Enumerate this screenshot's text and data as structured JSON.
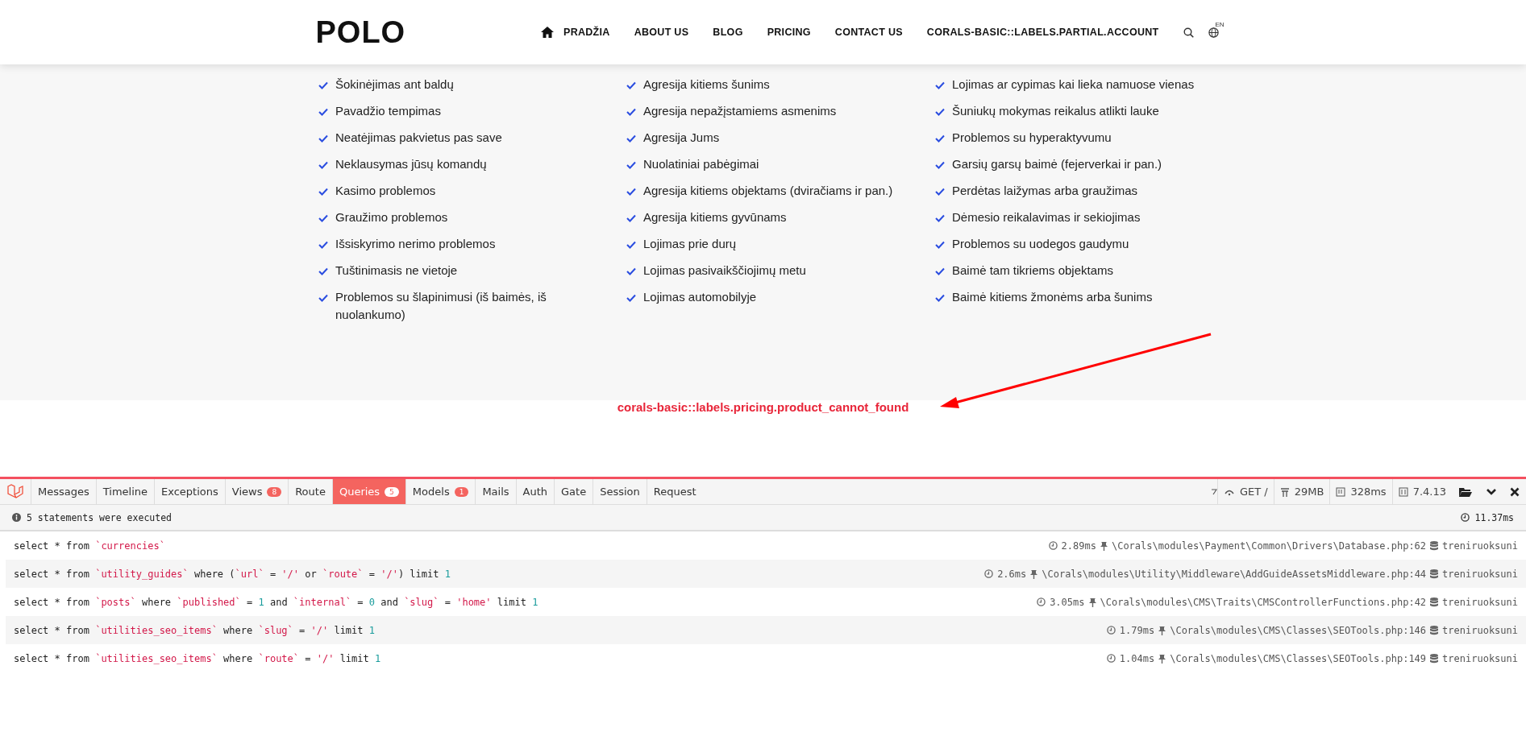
{
  "header": {
    "logo": "POLO",
    "nav": [
      {
        "label": "PRADŽIA",
        "home": true
      },
      {
        "label": "ABOUT US",
        "home": false
      },
      {
        "label": "BLOG",
        "home": false
      },
      {
        "label": "PRICING",
        "home": false
      },
      {
        "label": "CONTACT US",
        "home": false
      },
      {
        "label": "CORALS-BASIC::LABELS.PARTIAL.ACCOUNT",
        "home": false
      }
    ],
    "language": "EN"
  },
  "problem_columns": [
    [
      "Šokinėjimas ant baldų",
      "Pavadžio tempimas",
      "Neatėjimas pakvietus pas save",
      "Neklausymas jūsų komandų",
      "Kasimo problemos",
      "Graužimo problemos",
      "Išsiskyrimo nerimo problemos",
      "Tuštinimasis ne vietoje",
      "Problemos su šlapinimusi (iš baimės, iš nuolankumo)"
    ],
    [
      "Agresija kitiems šunims",
      "Agresija nepažįstamiems asmenims",
      "Agresija Jums",
      "Nuolatiniai pabėgimai",
      "Agresija kitiems objektams (dviračiams ir pan.)",
      "Agresija kitiems gyvūnams",
      "Lojimas prie durų",
      "Lojimas pasivaikščiojimų metu",
      "Lojimas automobilyje"
    ],
    [
      "Lojimas ar cypimas kai lieka namuose vienas",
      "Šuniukų mokymas reikalus atlikti lauke",
      "Problemos su hyperaktyvumu",
      "Garsių garsų baimė (fejerverkai ir pan.)",
      "Perdėtas laižymas arba graužimas",
      "Dėmesio reikalavimas ir sekiojimas",
      "Problemos su uodegos gaudymu",
      "Baimė tam tikriems objektams",
      "Baimė kitiems žmonėms arba šunims"
    ]
  ],
  "error_message": "corals-basic::labels.pricing.product_cannot_found",
  "debugbar": {
    "tabs": [
      {
        "label": "Messages",
        "selected": false
      },
      {
        "label": "Timeline",
        "selected": false
      },
      {
        "label": "Exceptions",
        "selected": false
      },
      {
        "label": "Views",
        "badge": "8",
        "selected": false
      },
      {
        "label": "Route",
        "selected": false
      },
      {
        "label": "Queries",
        "badge": "5",
        "selected": true
      },
      {
        "label": "Models",
        "badge": "1",
        "selected": false
      },
      {
        "label": "Mails",
        "selected": false
      },
      {
        "label": "Auth",
        "selected": false
      },
      {
        "label": "Gate",
        "selected": false
      },
      {
        "label": "Session",
        "selected": false
      },
      {
        "label": "Request",
        "selected": false
      }
    ],
    "request": "GET /",
    "memory": "29MB",
    "duration": "328ms",
    "php_version": "7.4.13",
    "summary": "5 statements were executed",
    "total_time": "11.37ms",
    "queries": [
      {
        "sql": [
          {
            "kind": "text",
            "text": "select * from "
          },
          {
            "kind": "str",
            "text": "`currencies`"
          }
        ],
        "time": "2.89ms",
        "source": "\\Corals\\modules\\Payment\\Common\\Drivers\\Database.php:62",
        "connection": "treniruoksuni"
      },
      {
        "sql": [
          {
            "kind": "text",
            "text": "select * from "
          },
          {
            "kind": "str",
            "text": "`utility_guides`"
          },
          {
            "kind": "text",
            "text": " where ("
          },
          {
            "kind": "str",
            "text": "`url`"
          },
          {
            "kind": "text",
            "text": " = "
          },
          {
            "kind": "str",
            "text": "'/'"
          },
          {
            "kind": "text",
            "text": " or "
          },
          {
            "kind": "str",
            "text": "`route`"
          },
          {
            "kind": "text",
            "text": " = "
          },
          {
            "kind": "str",
            "text": "'/'"
          },
          {
            "kind": "text",
            "text": ") limit "
          },
          {
            "kind": "num",
            "text": "1"
          }
        ],
        "time": "2.6ms",
        "source": "\\Corals\\modules\\Utility\\Middleware\\AddGuideAssetsMiddleware.php:44",
        "connection": "treniruoksuni"
      },
      {
        "sql": [
          {
            "kind": "text",
            "text": "select * from "
          },
          {
            "kind": "str",
            "text": "`posts`"
          },
          {
            "kind": "text",
            "text": " where "
          },
          {
            "kind": "str",
            "text": "`published`"
          },
          {
            "kind": "text",
            "text": " = "
          },
          {
            "kind": "num",
            "text": "1"
          },
          {
            "kind": "text",
            "text": " and "
          },
          {
            "kind": "str",
            "text": "`internal`"
          },
          {
            "kind": "text",
            "text": " = "
          },
          {
            "kind": "num",
            "text": "0"
          },
          {
            "kind": "text",
            "text": " and "
          },
          {
            "kind": "str",
            "text": "`slug`"
          },
          {
            "kind": "text",
            "text": " = "
          },
          {
            "kind": "str",
            "text": "'home'"
          },
          {
            "kind": "text",
            "text": " limit "
          },
          {
            "kind": "num",
            "text": "1"
          }
        ],
        "time": "3.05ms",
        "source": "\\Corals\\modules\\CMS\\Traits\\CMSControllerFunctions.php:42",
        "connection": "treniruoksuni"
      },
      {
        "sql": [
          {
            "kind": "text",
            "text": "select * from "
          },
          {
            "kind": "str",
            "text": "`utilities_seo_items`"
          },
          {
            "kind": "text",
            "text": " where "
          },
          {
            "kind": "str",
            "text": "`slug`"
          },
          {
            "kind": "text",
            "text": " = "
          },
          {
            "kind": "str",
            "text": "'/'"
          },
          {
            "kind": "text",
            "text": " limit "
          },
          {
            "kind": "num",
            "text": "1"
          }
        ],
        "time": "1.79ms",
        "source": "\\Corals\\modules\\CMS\\Classes\\SEOTools.php:146",
        "connection": "treniruoksuni"
      },
      {
        "sql": [
          {
            "kind": "text",
            "text": "select * from "
          },
          {
            "kind": "str",
            "text": "`utilities_seo_items`"
          },
          {
            "kind": "text",
            "text": " where "
          },
          {
            "kind": "str",
            "text": "`route`"
          },
          {
            "kind": "text",
            "text": " = "
          },
          {
            "kind": "str",
            "text": "'/'"
          },
          {
            "kind": "text",
            "text": " limit "
          },
          {
            "kind": "num",
            "text": "1"
          }
        ],
        "time": "1.04ms",
        "source": "\\Corals\\modules\\CMS\\Classes\\SEOTools.php:149",
        "connection": "treniruoksuni"
      }
    ]
  }
}
